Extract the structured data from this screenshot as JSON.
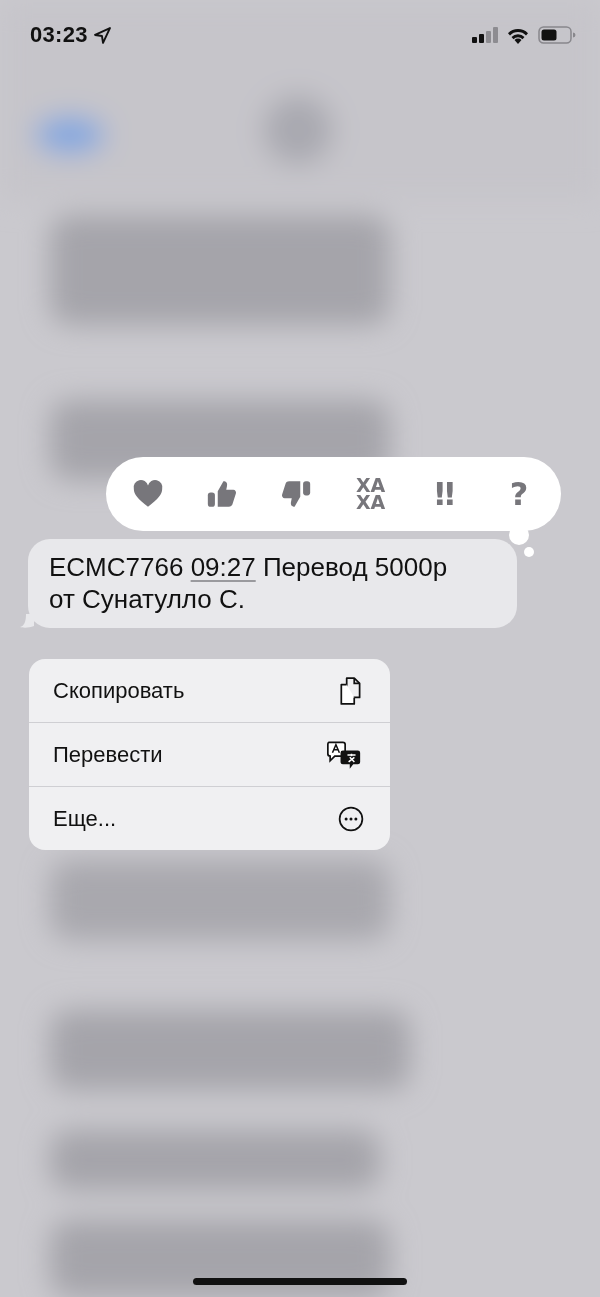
{
  "status_bar": {
    "time": "03:23",
    "location_active": true
  },
  "reactions": [
    {
      "kind": "heart"
    },
    {
      "kind": "thumbs-up"
    },
    {
      "kind": "thumbs-down"
    },
    {
      "kind": "text",
      "text": "ХА ХА"
    },
    {
      "kind": "text",
      "text": "‼"
    },
    {
      "kind": "text",
      "text": "?"
    }
  ],
  "message": {
    "before": "ECMC7766 ",
    "link": "09:27",
    "after": " Перевод 5000р от Сунатулло С."
  },
  "menu": [
    {
      "label": "Скопировать",
      "kind": "copy"
    },
    {
      "label": "Перевести",
      "kind": "translate"
    },
    {
      "label": "Еще...",
      "kind": "more"
    }
  ]
}
